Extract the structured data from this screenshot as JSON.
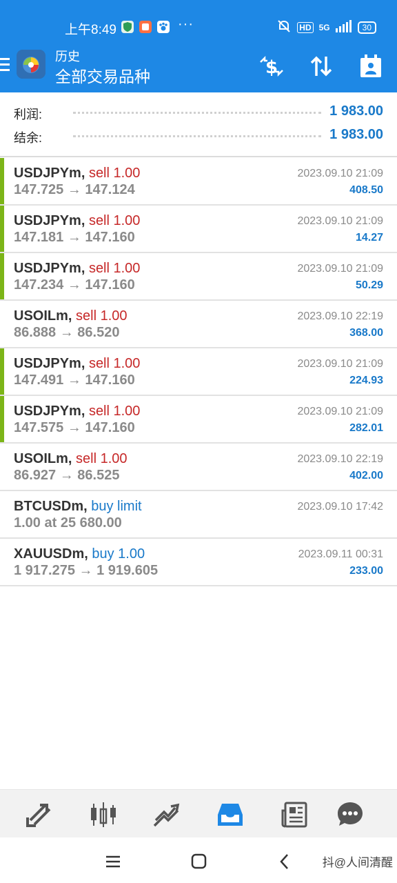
{
  "status_bar": {
    "time": "上午8:49",
    "dots": "···",
    "network": "5G",
    "hd": "HD",
    "battery": "30"
  },
  "header": {
    "title": "历史",
    "subtitle": "全部交易品种"
  },
  "summary": {
    "profit_label": "利润:",
    "profit_value": "1 983.00",
    "balance_label": "结余:",
    "balance_value": "1 983.00"
  },
  "trades": [
    {
      "symbol": "USDJPYm,",
      "action": "sell 1.00",
      "action_type": "sell",
      "prices": "147.725 → 147.124",
      "time": "2023.09.10 21:09",
      "profit": "408.50",
      "accent": true
    },
    {
      "symbol": "USDJPYm,",
      "action": "sell 1.00",
      "action_type": "sell",
      "prices": "147.181 → 147.160",
      "time": "2023.09.10 21:09",
      "profit": "14.27",
      "accent": true
    },
    {
      "symbol": "USDJPYm,",
      "action": "sell 1.00",
      "action_type": "sell",
      "prices": "147.234 → 147.160",
      "time": "2023.09.10 21:09",
      "profit": "50.29",
      "accent": true
    },
    {
      "symbol": "USOILm,",
      "action": "sell 1.00",
      "action_type": "sell",
      "prices": "86.888 → 86.520",
      "time": "2023.09.10 22:19",
      "profit": "368.00",
      "accent": false
    },
    {
      "symbol": "USDJPYm,",
      "action": "sell 1.00",
      "action_type": "sell",
      "prices": "147.491 → 147.160",
      "time": "2023.09.10 21:09",
      "profit": "224.93",
      "accent": true
    },
    {
      "symbol": "USDJPYm,",
      "action": "sell 1.00",
      "action_type": "sell",
      "prices": "147.575 → 147.160",
      "time": "2023.09.10 21:09",
      "profit": "282.01",
      "accent": true
    },
    {
      "symbol": "USOILm,",
      "action": "sell 1.00",
      "action_type": "sell",
      "prices": "86.927 → 86.525",
      "time": "2023.09.10 22:19",
      "profit": "402.00",
      "accent": false
    },
    {
      "symbol": "BTCUSDm,",
      "action": "buy limit",
      "action_type": "buy",
      "prices": "1.00 at 25 680.00",
      "time": "2023.09.10 17:42",
      "profit": "",
      "accent": false
    },
    {
      "symbol": "XAUUSDm,",
      "action": "buy 1.00",
      "action_type": "buy",
      "prices": "1 917.275 → 1 919.605",
      "time": "2023.09.11 00:31",
      "profit": "233.00",
      "accent": false
    }
  ],
  "bottom_nav": [
    {
      "icon": "quotes-icon",
      "active": false
    },
    {
      "icon": "chart-icon",
      "active": false
    },
    {
      "icon": "trade-icon",
      "active": false
    },
    {
      "icon": "history-icon",
      "active": true
    },
    {
      "icon": "news-icon",
      "active": false
    },
    {
      "icon": "chat-icon",
      "active": false
    }
  ],
  "watermark": "抖@人间清醒",
  "colors": {
    "primary": "#1e88e5",
    "profit": "#1979c9",
    "sell": "#c62828",
    "accent_bar": "#7cb518"
  }
}
